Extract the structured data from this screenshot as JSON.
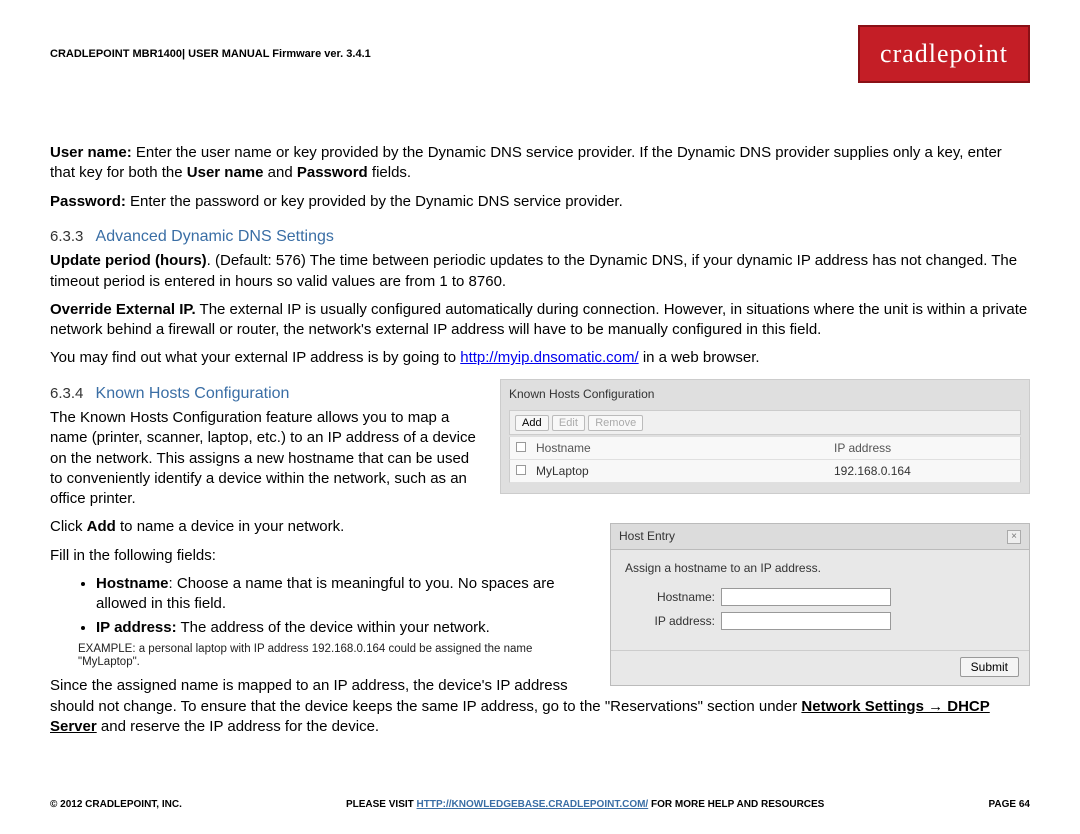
{
  "header": {
    "label": "CRADLEPOINT MBR1400| USER MANUAL Firmware ver. 3.4.1",
    "logo": "cradlepoint"
  },
  "p_username_label": "User name:",
  "p_username_text": " Enter the user name or key provided by the Dynamic DNS service provider. If the Dynamic DNS provider supplies only a key, enter that key for both the ",
  "p_username_b1": "User name",
  "p_username_mid": " and ",
  "p_username_b2": "Password",
  "p_username_end": " fields.",
  "p_password_label": "Password:",
  "p_password_text": " Enter the password or key provided by the Dynamic DNS service provider.",
  "sec633_num": "6.3.3",
  "sec633_title": "Advanced Dynamic DNS Settings",
  "p_update_label": "Update period (hours)",
  "p_update_text": ". (Default: 576) The time between periodic updates to the Dynamic DNS, if your dynamic IP address has not changed. The timeout period is entered in hours so valid values are from 1 to 8760.",
  "p_override_label": "Override External IP.",
  "p_override_text": " The external IP is usually configured automatically during connection. However, in situations where the unit is within a private network behind a firewall or router, the network's external IP address will have to be manually configured in this field.",
  "p_findip_pre": "You may find out what your external IP address is by going to ",
  "p_findip_link": "http://myip.dnsomatic.com/",
  "p_findip_post": " in a web browser.",
  "sec634_num": "6.3.4",
  "sec634_title": "Known Hosts Configuration",
  "p_known_text": "The Known Hosts Configuration feature allows you to map a name (printer, scanner, laptop, etc.) to an IP address of a device on the network. This assigns a new hostname that can be used to conveniently identify a device within the network, such as an office printer.",
  "p_click_pre": "Click ",
  "p_click_b": "Add",
  "p_click_post": " to name a device in your network.",
  "p_fill": "Fill in the following fields:",
  "bullet1_b": "Hostname",
  "bullet1_t": ": Choose a name that is meaningful to you. No spaces are allowed in this field.",
  "bullet2_b": "IP address:",
  "bullet2_t": " The address of the device within your network.",
  "example": "EXAMPLE: a personal laptop with IP address 192.168.0.164 could be assigned the name \"MyLaptop\".",
  "p_since_pre": "Since the assigned name is mapped to an IP address, the device's IP address should not change. To ensure that the device keeps the same IP address, go to the \"Reservations\" section under ",
  "p_since_b": "Network Settings → DHCP Server",
  "p_since_post": " and reserve the IP address for the device.",
  "panel1": {
    "title": "Known Hosts Configuration",
    "btn_add": "Add",
    "btn_edit": "Edit",
    "btn_remove": "Remove",
    "col_host": "Hostname",
    "col_ip": "IP address",
    "row_host": "MyLaptop",
    "row_ip": "192.168.0.164"
  },
  "panel2": {
    "title": "Host Entry",
    "desc": "Assign a hostname to an IP address.",
    "label_host": "Hostname:",
    "label_ip": "IP address:",
    "value_host": "",
    "value_ip": "",
    "submit": "Submit"
  },
  "footer": {
    "left": "© 2012 CRADLEPOINT, INC.",
    "mid_pre": "PLEASE VISIT ",
    "mid_link": "HTTP://KNOWLEDGEBASE.CRADLEPOINT.COM/",
    "mid_post": " FOR MORE HELP AND RESOURCES",
    "right": "PAGE 64"
  }
}
